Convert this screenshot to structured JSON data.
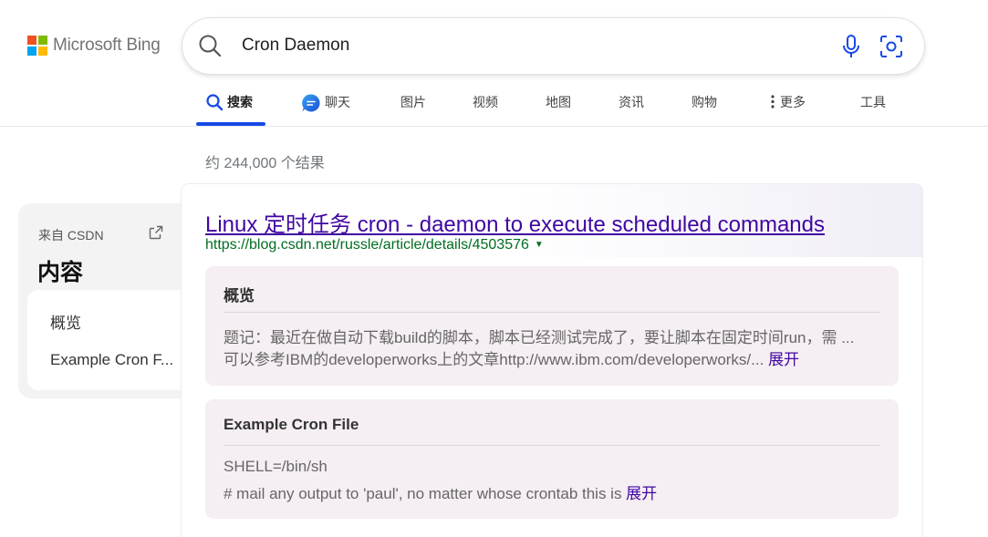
{
  "brand": {
    "name": "Microsoft Bing"
  },
  "search": {
    "query": "Cron Daemon"
  },
  "tabs": [
    {
      "label": "搜索",
      "icon": "search-icon"
    },
    {
      "label": "聊天",
      "icon": "copilot-chat-icon"
    },
    {
      "label": "图片"
    },
    {
      "label": "视频"
    },
    {
      "label": "地图"
    },
    {
      "label": "资讯"
    },
    {
      "label": "购物"
    },
    {
      "label": "更多",
      "icon": "more-vertical-icon"
    },
    {
      "label": "工具"
    }
  ],
  "results_count": "约 244,000 个结果",
  "toc": {
    "source": "来自 CSDN",
    "title": "内容",
    "items": [
      "概览",
      "Example Cron F..."
    ]
  },
  "result": {
    "title": "Linux 定时任务 cron - daemon to execute scheduled commands",
    "url": "https://blog.csdn.net/russle/article/details/4503576",
    "sections": [
      {
        "heading": "概览",
        "lines": [
          "题记：最近在做自动下载build的脚本，脚本已经测试完成了，要让脚本在固定时间run，需 ...",
          "可以参考IBM的developerworks上的文章http://www.ibm.com/developerworks/... "
        ],
        "expand": "展开"
      },
      {
        "heading": "Example Cron File",
        "lines": [
          "SHELL=/bin/sh",
          "# mail any output to 'paul', no matter whose crontab this is "
        ],
        "expand": "展开"
      }
    ]
  },
  "colors": {
    "accent": "#174ae4",
    "link_visited": "#4007a2",
    "url_green": "#006d21",
    "section_bg": "#f5eef3"
  }
}
